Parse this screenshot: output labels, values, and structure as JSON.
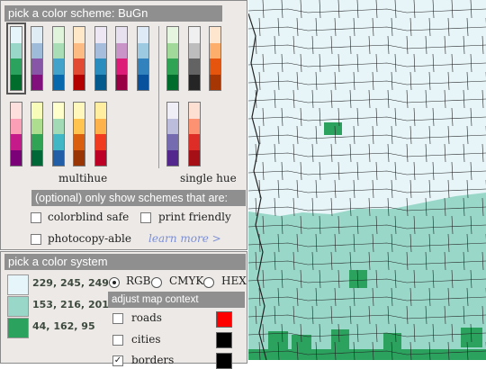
{
  "scheme_panel": {
    "title": "pick a color scheme: BuGn",
    "multihue_label": "multihue",
    "singlehue_label": "single hue",
    "filter_title": "(optional) only show schemes that are:",
    "colorblind_label": "colorblind safe",
    "print_label": "print friendly",
    "photocopy_label": "photocopy-able",
    "learn_more": "learn more >"
  },
  "system_panel": {
    "title": "pick a color system",
    "rgb_label": "RGB",
    "cmyk_label": "CMYK",
    "hex_label": "HEX",
    "selected": "RGB",
    "colors": [
      {
        "value": "229, 245, 249",
        "hex": "#e5f5f9"
      },
      {
        "value": "153, 216, 201",
        "hex": "#99d8c9"
      },
      {
        "value": "44, 162, 95",
        "hex": "#2ca25f"
      }
    ]
  },
  "context_panel": {
    "title": "adjust map context",
    "roads_label": "roads",
    "cities_label": "cities",
    "borders_label": "borders",
    "roads_color": "#ff0000",
    "cities_color": "#000000",
    "borders_color": "#000000"
  },
  "schemes_row1": [
    [
      "#e5f5f9",
      "#99d8c9",
      "#2ca25f",
      "#006d2c"
    ],
    [
      "#e0ecf4",
      "#9ebcda",
      "#8856a7",
      "#810f7c"
    ],
    [
      "#e0f3db",
      "#a8ddb5",
      "#43a2ca",
      "#0868ac"
    ],
    [
      "#fee8c8",
      "#fdbb84",
      "#e34a33",
      "#b30000"
    ],
    [
      "#ece7f2",
      "#a6bddb",
      "#2b8cbe",
      "#045a8d"
    ],
    [
      "#e7e1ef",
      "#c994c7",
      "#dd1c77",
      "#980043"
    ],
    [
      "#deebf7",
      "#9ecae1",
      "#3182bd",
      "#08519c"
    ],
    [
      "#e5f5e0",
      "#a1d99b",
      "#31a354",
      "#006d2c"
    ],
    [
      "#f0f0f0",
      "#bdbdbd",
      "#636363",
      "#252525"
    ],
    [
      "#fee6ce",
      "#fdae6b",
      "#e6550d",
      "#a63603"
    ]
  ],
  "schemes_row2": [
    [
      "#fde0dd",
      "#fa9fb5",
      "#c51b8a",
      "#7a0177"
    ],
    [
      "#f7fcb9",
      "#addd8e",
      "#31a354",
      "#006837"
    ],
    [
      "#ffffcc",
      "#a1dab4",
      "#41b6c4",
      "#225ea8"
    ],
    [
      "#fff7bc",
      "#fec44f",
      "#d95f0e",
      "#993404"
    ],
    [
      "#ffeda0",
      "#feb24c",
      "#f03b20",
      "#bd0026"
    ],
    [
      "#efedf5",
      "#bcbddc",
      "#756bb1",
      "#54278f"
    ],
    [
      "#fee0d2",
      "#fc9272",
      "#de2d26",
      "#a50f15"
    ]
  ]
}
